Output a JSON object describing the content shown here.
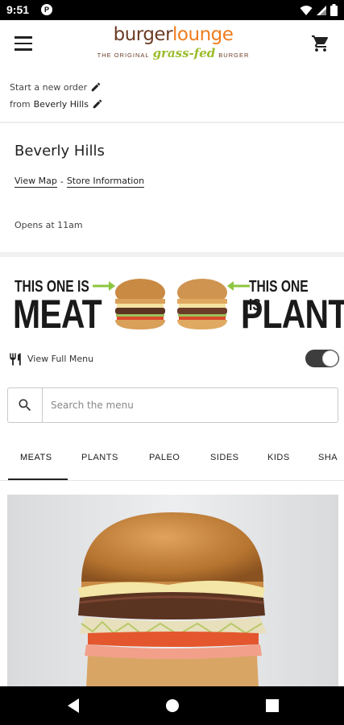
{
  "status_bar": {
    "time": "9:51",
    "notification_icon": "P"
  },
  "app_bar": {
    "logo": {
      "word1": "burger",
      "word2": "lounge",
      "tagline_left": "THE ORIGINAL",
      "tagline_mid": "grass-fed",
      "tagline_right": "BURGER"
    }
  },
  "order": {
    "line1": "Start a new order",
    "line2_prefix": "from",
    "store": "Beverly Hills"
  },
  "store_card": {
    "name": "Beverly Hills",
    "view_map": "View Map",
    "separator": "-",
    "store_info": "Store Information",
    "opens": "Opens at 11am"
  },
  "banner": {
    "left_small": "THIS ONE IS",
    "left_big": "MEAT",
    "right_small": "THIS ONE IS",
    "right_big": "PLANT"
  },
  "view_menu": {
    "label": "View Full Menu",
    "toggle_on": true
  },
  "search": {
    "placeholder": "Search the menu",
    "value": ""
  },
  "tabs": [
    {
      "label": "MEATS"
    },
    {
      "label": "PLANTS"
    },
    {
      "label": "PALEO"
    },
    {
      "label": "SIDES"
    },
    {
      "label": "KIDS"
    },
    {
      "label": "SHA"
    }
  ],
  "active_tab": "MEATS",
  "colors": {
    "brand_brown": "#6b3c26",
    "brand_orange": "#f07c1e",
    "brand_green": "#9bbc2c",
    "arrow_green": "#8dc63f"
  }
}
